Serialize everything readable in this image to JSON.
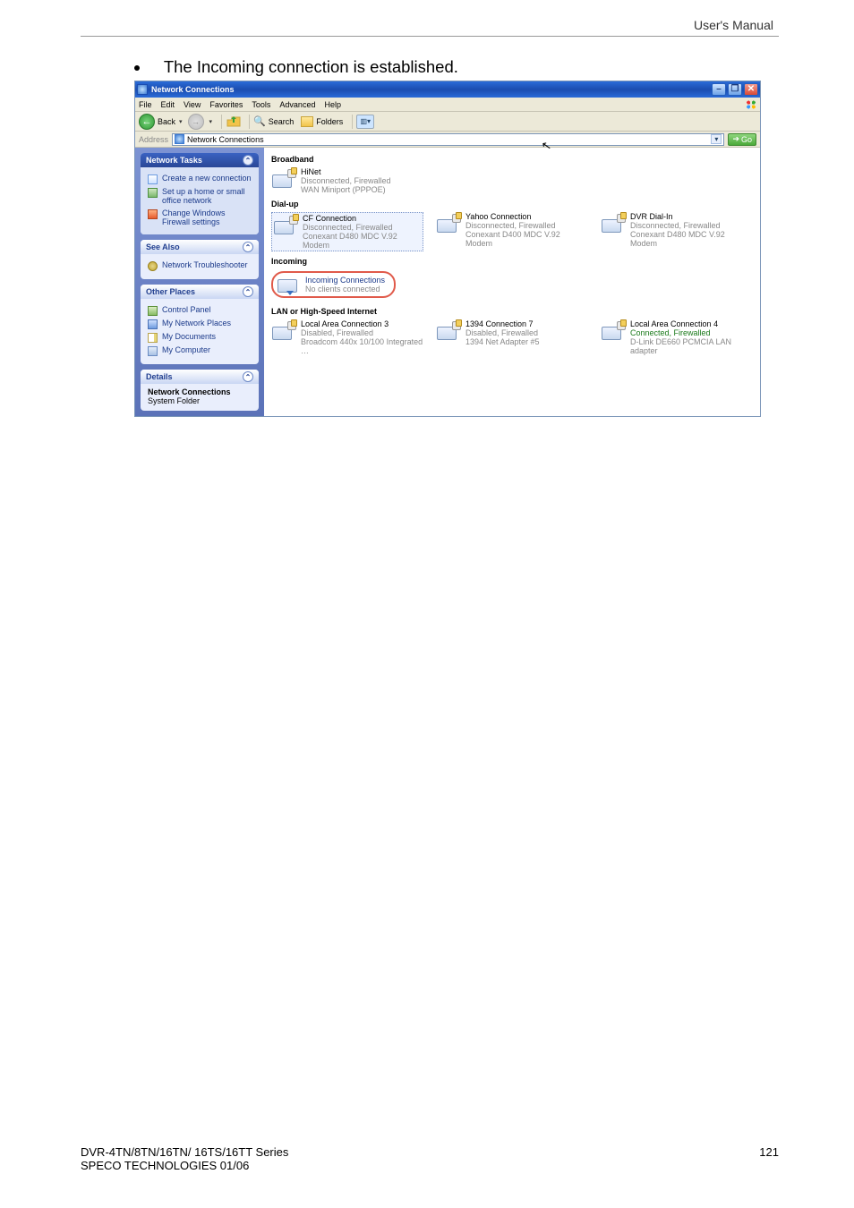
{
  "page": {
    "header_right": "User's Manual",
    "bullet_text": "The Incoming connection is established.",
    "footer_left_line1": "DVR-4TN/8TN/16TN/ 16TS/16TT Series",
    "footer_left_line2": "SPECO TECHNOLOGIES 01/06",
    "footer_page": "121"
  },
  "window": {
    "title": "Network Connections"
  },
  "menu": {
    "file": "File",
    "edit": "Edit",
    "view": "View",
    "favorites": "Favorites",
    "tools": "Tools",
    "advanced": "Advanced",
    "help": "Help"
  },
  "toolbar": {
    "back": "Back",
    "search": "Search",
    "folders": "Folders"
  },
  "addressbar": {
    "label": "Address",
    "field": "Network Connections",
    "go": "Go"
  },
  "left": {
    "tasks": {
      "title": "Network Tasks",
      "items": [
        "Create a new connection",
        "Set up a home or small office network",
        "Change Windows Firewall settings"
      ]
    },
    "seealso": {
      "title": "See Also",
      "items": [
        "Network Troubleshooter"
      ]
    },
    "other": {
      "title": "Other Places",
      "items": [
        "Control Panel",
        "My Network Places",
        "My Documents",
        "My Computer"
      ]
    },
    "details": {
      "title": "Details",
      "line1": "Network Connections",
      "line2": "System Folder"
    }
  },
  "right": {
    "cursor_glyph": "↖",
    "groups": {
      "broadband": {
        "title": "Broadband",
        "items": [
          {
            "name": "HiNet",
            "status": "Disconnected, Firewalled",
            "device": "WAN Miniport (PPPOE)"
          }
        ]
      },
      "dialup": {
        "title": "Dial-up",
        "items": [
          {
            "name": "CF Connection",
            "status": "Disconnected, Firewalled",
            "device": "Conexant D480 MDC V.92 Modem",
            "selected": true
          },
          {
            "name": "Yahoo Connection",
            "status": "Disconnected, Firewalled",
            "device": "Conexant D400 MDC V.92 Modem"
          },
          {
            "name": "DVR Dial-In",
            "status": "Disconnected, Firewalled",
            "device": "Conexant D480 MDC V.92 Modem"
          }
        ]
      },
      "incoming": {
        "title": "Incoming",
        "items": [
          {
            "name": "Incoming Connections",
            "status": "No clients connected"
          }
        ]
      },
      "lan": {
        "title": "LAN or High-Speed Internet",
        "items": [
          {
            "name": "Local Area Connection 3",
            "status": "Disabled, Firewalled",
            "device": "Broadcom 440x 10/100 Integrated …"
          },
          {
            "name": "1394 Connection 7",
            "status": "Disabled, Firewalled",
            "device": "1394 Net Adapter #5"
          },
          {
            "name": "Local Area Connection 4",
            "status": "Connected, Firewalled",
            "device": "D-Link DE660 PCMCIA LAN adapter",
            "connected": true
          }
        ]
      }
    }
  }
}
